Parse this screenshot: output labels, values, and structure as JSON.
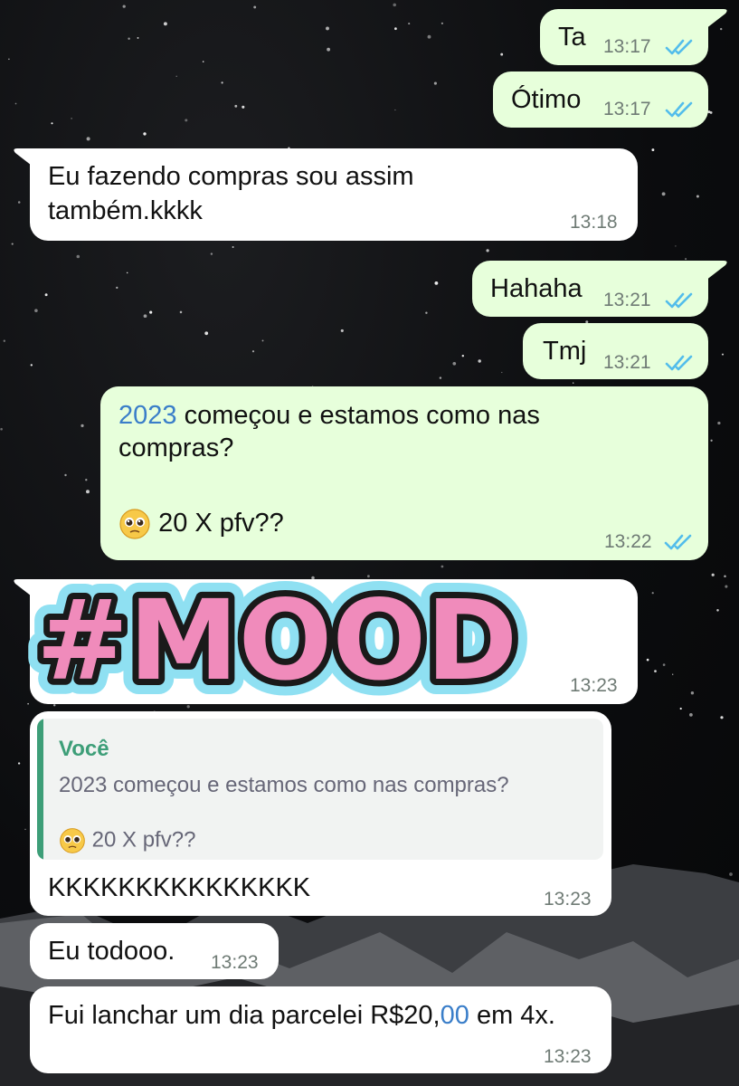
{
  "messages": [
    {
      "text": "Ta",
      "time": "13:17"
    },
    {
      "text": "Ótimo",
      "time": "13:17"
    },
    {
      "line1": "Eu fazendo compras sou assim",
      "line2": "também.kkkk",
      "time": "13:18"
    },
    {
      "text": "Hahaha",
      "time": "13:21"
    },
    {
      "text": "Tmj",
      "time": "13:21"
    },
    {
      "link": "2023",
      "line1_rest": " começou e estamos como nas",
      "line2": "compras?",
      "line3": "20 X pfv??",
      "time": "13:22"
    },
    {
      "sticker_text": "#MOOD",
      "time": "13:23"
    },
    {
      "quote_author": "Você",
      "quote_line1": "2023 começou e estamos como nas compras?",
      "quote_line2": "20 X pfv??",
      "text": "KKKKKKKKKKKKKKK",
      "time": "13:23"
    },
    {
      "text": "Eu todooo.",
      "time": "13:23"
    },
    {
      "text_start": "Fui lanchar um dia parcelei R$20,",
      "text_link": "00",
      "text_end": " em 4x.",
      "time": "13:23"
    }
  ],
  "colors": {
    "outgoing": "#e7ffdb",
    "incoming": "#ffffff",
    "read_ticks": "#53bdeb",
    "quote_author": "#3d9e78",
    "link": "#3a7ec9"
  },
  "icons": {
    "read_receipt": "double-check-icon",
    "emoji": "pleading-face-icon"
  }
}
